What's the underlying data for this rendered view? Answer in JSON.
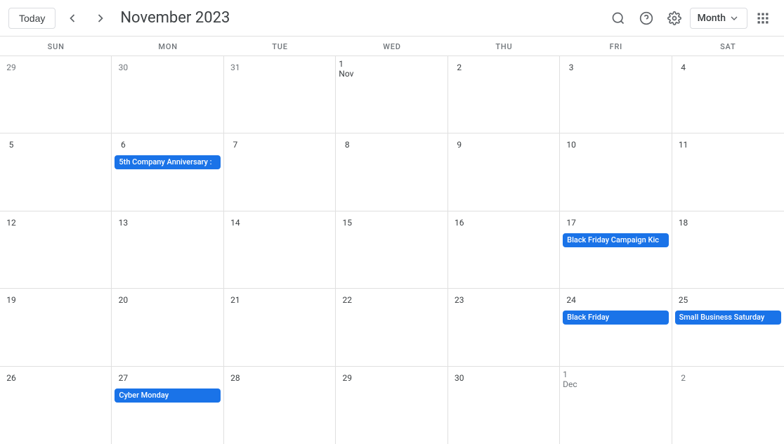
{
  "header": {
    "today_label": "Today",
    "title": "November 2023",
    "view_label": "Month",
    "prev_icon": "‹",
    "next_icon": "›"
  },
  "day_headers": [
    "SUN",
    "MON",
    "TUE",
    "WED",
    "THU",
    "FRI",
    "SAT"
  ],
  "weeks": [
    {
      "days": [
        {
          "num": "29",
          "other": true,
          "events": []
        },
        {
          "num": "30",
          "other": true,
          "events": []
        },
        {
          "num": "31",
          "other": true,
          "events": []
        },
        {
          "num": "1 Nov",
          "events": []
        },
        {
          "num": "2",
          "events": []
        },
        {
          "num": "3",
          "events": []
        },
        {
          "num": "4",
          "events": []
        }
      ]
    },
    {
      "days": [
        {
          "num": "5",
          "events": []
        },
        {
          "num": "6",
          "events": [
            {
              "label": "5th Company Anniversary :"
            }
          ]
        },
        {
          "num": "7",
          "events": []
        },
        {
          "num": "8",
          "events": []
        },
        {
          "num": "9",
          "events": []
        },
        {
          "num": "10",
          "events": []
        },
        {
          "num": "11",
          "events": []
        }
      ]
    },
    {
      "days": [
        {
          "num": "12",
          "events": []
        },
        {
          "num": "13",
          "events": []
        },
        {
          "num": "14",
          "events": []
        },
        {
          "num": "15",
          "events": []
        },
        {
          "num": "16",
          "events": []
        },
        {
          "num": "17",
          "events": [
            {
              "label": "Black Friday Campaign Kic"
            }
          ]
        },
        {
          "num": "18",
          "events": []
        }
      ]
    },
    {
      "days": [
        {
          "num": "19",
          "events": []
        },
        {
          "num": "20",
          "events": []
        },
        {
          "num": "21",
          "events": []
        },
        {
          "num": "22",
          "events": []
        },
        {
          "num": "23",
          "events": []
        },
        {
          "num": "24",
          "events": [
            {
              "label": "Black Friday"
            }
          ]
        },
        {
          "num": "25",
          "events": [
            {
              "label": "Small Business Saturday"
            }
          ]
        }
      ]
    },
    {
      "days": [
        {
          "num": "26",
          "events": []
        },
        {
          "num": "27",
          "events": [
            {
              "label": "Cyber Monday"
            }
          ]
        },
        {
          "num": "28",
          "events": []
        },
        {
          "num": "29",
          "events": []
        },
        {
          "num": "30",
          "events": []
        },
        {
          "num": "1 Dec",
          "other": true,
          "events": []
        },
        {
          "num": "2",
          "other": true,
          "events": []
        }
      ]
    }
  ]
}
